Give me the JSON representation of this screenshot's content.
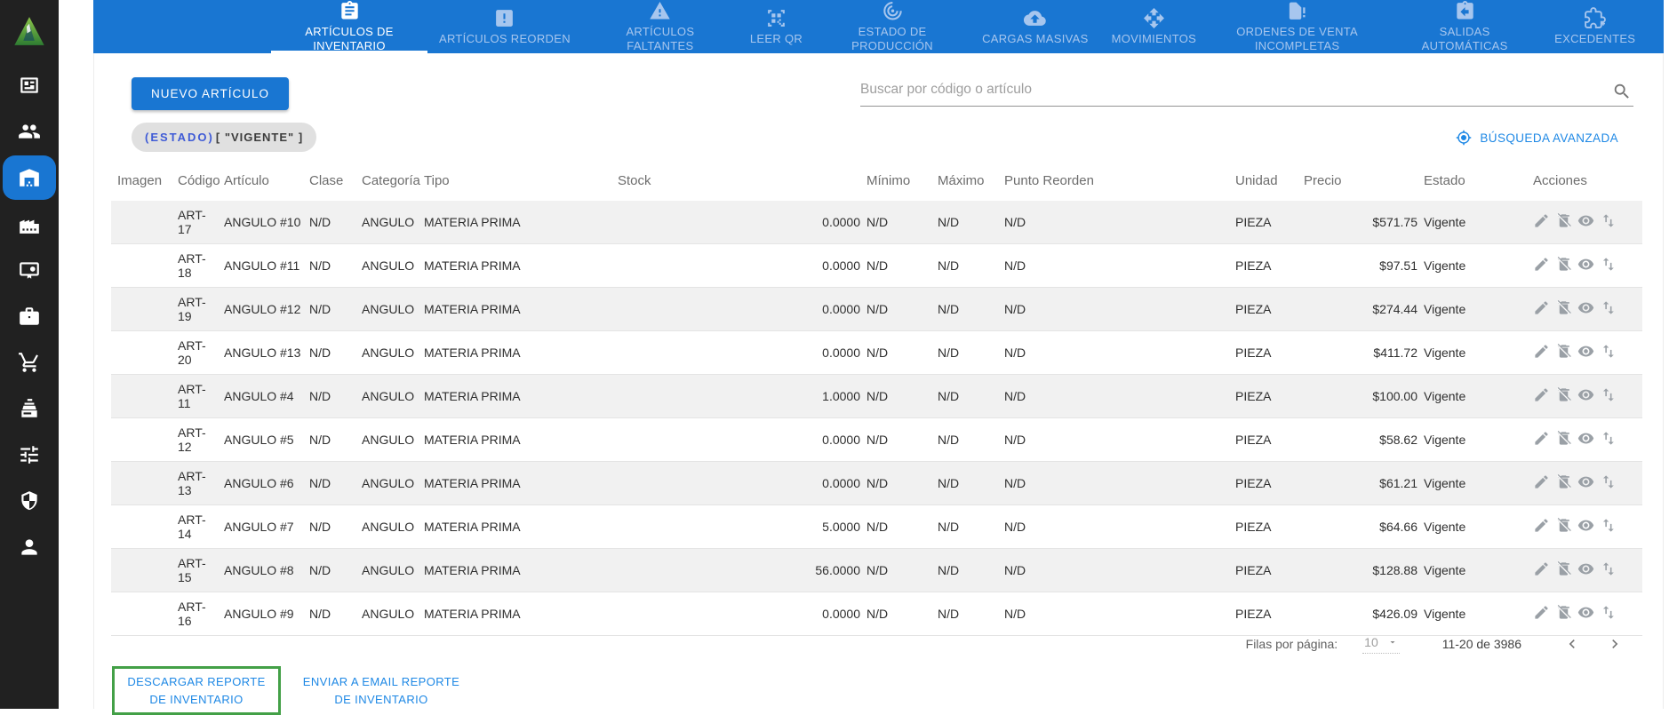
{
  "colors": {
    "primary_blue": "#1976d2",
    "link_blue": "#1e88e5",
    "highlight_green": "#43a047",
    "sidebar_bg": "#212121",
    "chip_bg": "#e0e0e0",
    "row_stripe": "#f1f1f1"
  },
  "sidebar": {
    "items": [
      {
        "icon": "news-icon",
        "active": false
      },
      {
        "icon": "people-icon",
        "active": false
      },
      {
        "icon": "warehouse-icon",
        "active": true
      },
      {
        "icon": "factory-icon",
        "active": false
      },
      {
        "icon": "certificate-icon",
        "active": false
      },
      {
        "icon": "briefcase-icon",
        "active": false
      },
      {
        "icon": "cart-icon",
        "active": false
      },
      {
        "icon": "cash-register-icon",
        "active": false
      },
      {
        "icon": "tune-icon",
        "active": false
      },
      {
        "icon": "shield-icon",
        "active": false
      },
      {
        "icon": "person-icon",
        "active": false
      }
    ]
  },
  "topnav": {
    "tabs": [
      {
        "label": "ARTÍCULOS DE INVENTARIO",
        "icon": "clipboard-icon",
        "active": true
      },
      {
        "label": "ARTÍCULOS REORDEN",
        "icon": "box-alert-icon",
        "active": false
      },
      {
        "label": "ARTÍCULOS FALTANTES",
        "icon": "warning-icon",
        "active": false
      },
      {
        "label": "LEER QR",
        "icon": "qr-icon",
        "active": false
      },
      {
        "label": "ESTADO DE PRODUCCIÓN",
        "icon": "spiral-icon",
        "active": false
      },
      {
        "label": "CARGAS MASIVAS",
        "icon": "cloud-upload-icon",
        "active": false
      },
      {
        "label": "MOVIMIENTOS",
        "icon": "move-icon",
        "active": false
      },
      {
        "label": "ORDENES DE VENTA INCOMPLETAS",
        "icon": "doc-alert-icon",
        "active": false
      },
      {
        "label": "SALIDAS AUTOMÁTICAS",
        "icon": "clipboard-return-icon",
        "active": false
      },
      {
        "label": "EXCEDENTES",
        "icon": "puzzle-plus-icon",
        "active": false
      }
    ]
  },
  "toolbar": {
    "new_article_label": "NUEVO ARTÍCULO",
    "search_placeholder": "Buscar por código o artículo",
    "filter_chip": {
      "field": "(ESTADO)",
      "value": "[ \"VIGENTE\" ]"
    },
    "advanced_search_label": "BÚSQUEDA AVANZADA"
  },
  "table": {
    "columns": [
      "Imagen",
      "Código",
      "Artículo",
      "Clase",
      "Categoría",
      "Tipo",
      "Stock",
      "Mínimo",
      "Máximo",
      "Punto Reorden",
      "Unidad",
      "Precio",
      "Estado",
      "Acciones"
    ],
    "action_icons": [
      "pencil-icon",
      "delete-disabled-icon",
      "eye-icon",
      "import-export-icon"
    ],
    "rows": [
      {
        "imagen": "",
        "codigo": "ART-17",
        "articulo": "ANGULO #10",
        "clase": "N/D",
        "categoria": "ANGULO",
        "tipo": "MATERIA PRIMA",
        "stock": "0.0000",
        "minimo": "N/D",
        "maximo": "N/D",
        "punto_reorden": "N/D",
        "unidad": "PIEZA",
        "precio": "$571.75",
        "estado": "Vigente"
      },
      {
        "imagen": "",
        "codigo": "ART-18",
        "articulo": "ANGULO #11",
        "clase": "N/D",
        "categoria": "ANGULO",
        "tipo": "MATERIA PRIMA",
        "stock": "0.0000",
        "minimo": "N/D",
        "maximo": "N/D",
        "punto_reorden": "N/D",
        "unidad": "PIEZA",
        "precio": "$97.51",
        "estado": "Vigente"
      },
      {
        "imagen": "",
        "codigo": "ART-19",
        "articulo": "ANGULO #12",
        "clase": "N/D",
        "categoria": "ANGULO",
        "tipo": "MATERIA PRIMA",
        "stock": "0.0000",
        "minimo": "N/D",
        "maximo": "N/D",
        "punto_reorden": "N/D",
        "unidad": "PIEZA",
        "precio": "$274.44",
        "estado": "Vigente"
      },
      {
        "imagen": "",
        "codigo": "ART-20",
        "articulo": "ANGULO #13",
        "clase": "N/D",
        "categoria": "ANGULO",
        "tipo": "MATERIA PRIMA",
        "stock": "0.0000",
        "minimo": "N/D",
        "maximo": "N/D",
        "punto_reorden": "N/D",
        "unidad": "PIEZA",
        "precio": "$411.72",
        "estado": "Vigente"
      },
      {
        "imagen": "",
        "codigo": "ART-11",
        "articulo": "ANGULO #4",
        "clase": "N/D",
        "categoria": "ANGULO",
        "tipo": "MATERIA PRIMA",
        "stock": "1.0000",
        "minimo": "N/D",
        "maximo": "N/D",
        "punto_reorden": "N/D",
        "unidad": "PIEZA",
        "precio": "$100.00",
        "estado": "Vigente"
      },
      {
        "imagen": "",
        "codigo": "ART-12",
        "articulo": "ANGULO #5",
        "clase": "N/D",
        "categoria": "ANGULO",
        "tipo": "MATERIA PRIMA",
        "stock": "0.0000",
        "minimo": "N/D",
        "maximo": "N/D",
        "punto_reorden": "N/D",
        "unidad": "PIEZA",
        "precio": "$58.62",
        "estado": "Vigente"
      },
      {
        "imagen": "",
        "codigo": "ART-13",
        "articulo": "ANGULO #6",
        "clase": "N/D",
        "categoria": "ANGULO",
        "tipo": "MATERIA PRIMA",
        "stock": "0.0000",
        "minimo": "N/D",
        "maximo": "N/D",
        "punto_reorden": "N/D",
        "unidad": "PIEZA",
        "precio": "$61.21",
        "estado": "Vigente"
      },
      {
        "imagen": "",
        "codigo": "ART-14",
        "articulo": "ANGULO #7",
        "clase": "N/D",
        "categoria": "ANGULO",
        "tipo": "MATERIA PRIMA",
        "stock": "5.0000",
        "minimo": "N/D",
        "maximo": "N/D",
        "punto_reorden": "N/D",
        "unidad": "PIEZA",
        "precio": "$64.66",
        "estado": "Vigente"
      },
      {
        "imagen": "",
        "codigo": "ART-15",
        "articulo": "ANGULO #8",
        "clase": "N/D",
        "categoria": "ANGULO",
        "tipo": "MATERIA PRIMA",
        "stock": "56.0000",
        "minimo": "N/D",
        "maximo": "N/D",
        "punto_reorden": "N/D",
        "unidad": "PIEZA",
        "precio": "$128.88",
        "estado": "Vigente"
      },
      {
        "imagen": "",
        "codigo": "ART-16",
        "articulo": "ANGULO #9",
        "clase": "N/D",
        "categoria": "ANGULO",
        "tipo": "MATERIA PRIMA",
        "stock": "0.0000",
        "minimo": "N/D",
        "maximo": "N/D",
        "punto_reorden": "N/D",
        "unidad": "PIEZA",
        "precio": "$426.09",
        "estado": "Vigente"
      }
    ]
  },
  "pagination": {
    "rows_per_page_label": "Filas por página:",
    "rows_per_page_value": "10",
    "range_label": "11-20 de 3986"
  },
  "footer": {
    "download_report_label": "DESCARGAR REPORTE DE INVENTARIO",
    "email_report_label": "ENVIAR A EMAIL REPORTE DE INVENTARIO"
  }
}
